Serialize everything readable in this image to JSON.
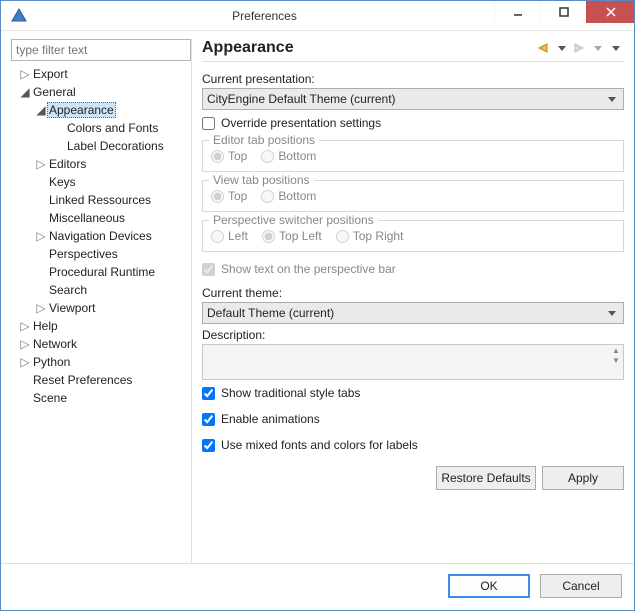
{
  "window": {
    "title": "Preferences"
  },
  "filter": {
    "placeholder": "type filter text"
  },
  "tree": {
    "items": [
      {
        "label": "Export",
        "level": 1,
        "exp": "collapsed",
        "selected": false
      },
      {
        "label": "General",
        "level": 1,
        "exp": "expanded",
        "selected": false
      },
      {
        "label": "Appearance",
        "level": 2,
        "exp": "expanded",
        "selected": true
      },
      {
        "label": "Colors and Fonts",
        "level": 3,
        "exp": "none",
        "selected": false
      },
      {
        "label": "Label Decorations",
        "level": 3,
        "exp": "none",
        "selected": false
      },
      {
        "label": "Editors",
        "level": 2,
        "exp": "collapsed",
        "selected": false
      },
      {
        "label": "Keys",
        "level": 2,
        "exp": "none",
        "selected": false
      },
      {
        "label": "Linked Ressources",
        "level": 2,
        "exp": "none",
        "selected": false
      },
      {
        "label": "Miscellaneous",
        "level": 2,
        "exp": "none",
        "selected": false
      },
      {
        "label": "Navigation Devices",
        "level": 2,
        "exp": "collapsed",
        "selected": false
      },
      {
        "label": "Perspectives",
        "level": 2,
        "exp": "none",
        "selected": false
      },
      {
        "label": "Procedural Runtime",
        "level": 2,
        "exp": "none",
        "selected": false
      },
      {
        "label": "Search",
        "level": 2,
        "exp": "none",
        "selected": false
      },
      {
        "label": "Viewport",
        "level": 2,
        "exp": "collapsed",
        "selected": false
      },
      {
        "label": "Help",
        "level": 1,
        "exp": "collapsed",
        "selected": false
      },
      {
        "label": "Network",
        "level": 1,
        "exp": "collapsed",
        "selected": false
      },
      {
        "label": "Python",
        "level": 1,
        "exp": "collapsed",
        "selected": false
      },
      {
        "label": "Reset Preferences",
        "level": 1,
        "exp": "none",
        "selected": false
      },
      {
        "label": "Scene",
        "level": 1,
        "exp": "none",
        "selected": false
      }
    ]
  },
  "page": {
    "heading": "Appearance",
    "currentPresentationLabel": "Current presentation:",
    "currentPresentationValue": "CityEngine Default Theme (current)",
    "overrideLabel": "Override presentation settings",
    "overrideChecked": false,
    "editorTabs": {
      "legend": "Editor tab positions",
      "options": [
        "Top",
        "Bottom"
      ],
      "selected": "Top"
    },
    "viewTabs": {
      "legend": "View tab positions",
      "options": [
        "Top",
        "Bottom"
      ],
      "selected": "Top"
    },
    "perspSwitch": {
      "legend": "Perspective switcher positions",
      "options": [
        "Left",
        "Top Left",
        "Top Right"
      ],
      "selected": "Top Left"
    },
    "showTextPerspBar": {
      "label": "Show text on the perspective bar",
      "checked": true
    },
    "currentThemeLabel": "Current theme:",
    "currentThemeValue": "Default Theme (current)",
    "descriptionLabel": "Description:",
    "traditionalTabs": {
      "label": "Show traditional style tabs",
      "checked": true
    },
    "enableAnimations": {
      "label": "Enable animations",
      "checked": true
    },
    "mixedFonts": {
      "label": "Use mixed fonts and colors for labels",
      "checked": true
    },
    "restoreDefaults": "Restore Defaults",
    "apply": "Apply"
  },
  "dialog": {
    "ok": "OK",
    "cancel": "Cancel"
  }
}
